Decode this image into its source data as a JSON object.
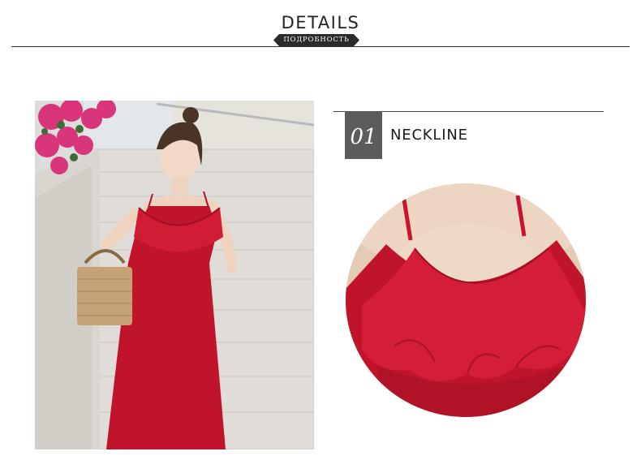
{
  "header": {
    "title": "DETAILS",
    "subtitle": "ПОДРОБНОСТЬ"
  },
  "detail": {
    "number": "01",
    "label": "NECKLINE"
  },
  "colors": {
    "dress": "#c0142c",
    "badge": "#2b2b2b",
    "number_box": "#5c5c5c",
    "flowers": "#d8357a"
  }
}
